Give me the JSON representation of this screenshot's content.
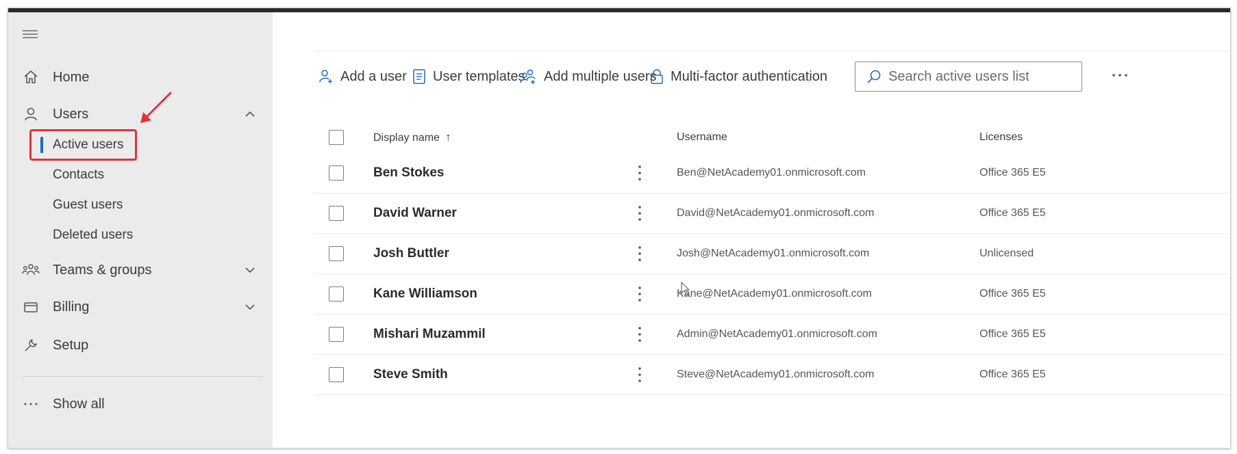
{
  "sidebar": {
    "items": [
      {
        "label": "Home",
        "icon": "home-icon"
      },
      {
        "label": "Users",
        "icon": "user-icon",
        "expanded": true
      },
      {
        "label": "Teams & groups",
        "icon": "teams-icon"
      },
      {
        "label": "Billing",
        "icon": "billing-icon"
      },
      {
        "label": "Setup",
        "icon": "wrench-icon"
      }
    ],
    "user_subitems": [
      {
        "label": "Active users",
        "active": true
      },
      {
        "label": "Contacts"
      },
      {
        "label": "Guest users"
      },
      {
        "label": "Deleted users"
      }
    ],
    "show_all": "Show all"
  },
  "toolbar": {
    "add_user": "Add a user",
    "user_templates": "User templates",
    "add_multiple": "Add multiple users",
    "mfa": "Multi-factor authentication"
  },
  "search": {
    "placeholder": "Search active users list"
  },
  "table": {
    "columns": {
      "display_name": "Display name",
      "sort_indicator": "↑",
      "username": "Username",
      "licenses": "Licenses"
    },
    "rows": [
      {
        "name": "Ben Stokes",
        "username": "Ben@NetAcademy01.onmicrosoft.com",
        "license": "Office 365 E5"
      },
      {
        "name": "David Warner",
        "username": "David@NetAcademy01.onmicrosoft.com",
        "license": "Office 365 E5"
      },
      {
        "name": "Josh Buttler",
        "username": "Josh@NetAcademy01.onmicrosoft.com",
        "license": "Unlicensed"
      },
      {
        "name": "Kane Williamson",
        "username": "Kane@NetAcademy01.onmicrosoft.com",
        "license": "Office 365 E5"
      },
      {
        "name": "Mishari Muzammil",
        "username": "Admin@NetAcademy01.onmicrosoft.com",
        "license": "Office 365 E5"
      },
      {
        "name": "Steve Smith",
        "username": "Steve@NetAcademy01.onmicrosoft.com",
        "license": "Office 365 E5"
      }
    ]
  },
  "colors": {
    "accent": "#2266c4",
    "annotation": "#e0323a",
    "sidebar_bg": "#ebebeb"
  }
}
